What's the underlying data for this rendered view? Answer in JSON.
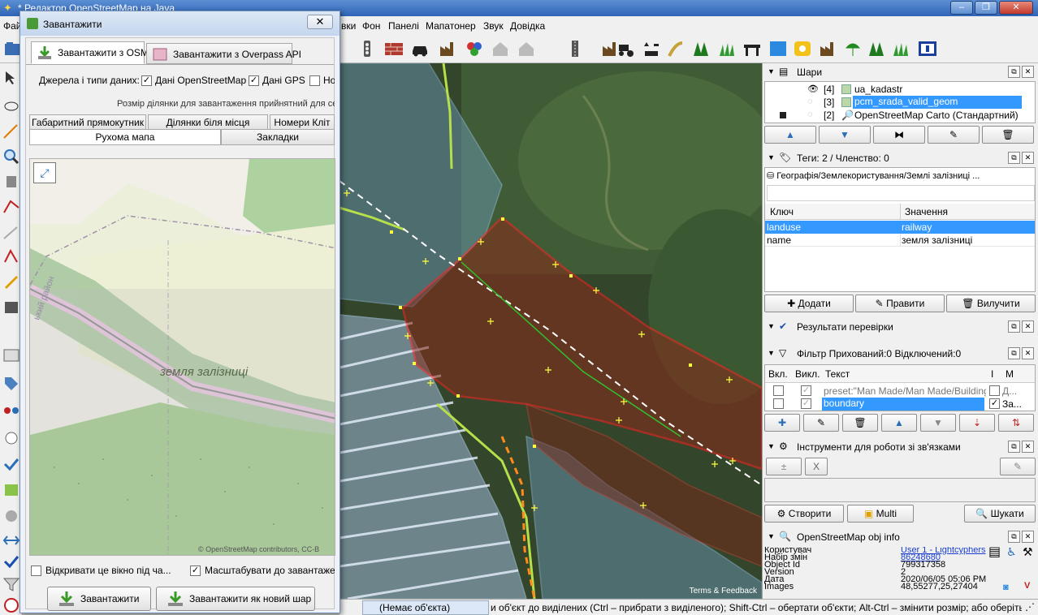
{
  "window": {
    "title": "* Редактор OpenStreetMap на Java"
  },
  "menu": {
    "items": [
      "Фай",
      "вки",
      "Фон",
      "Панелі",
      "Мапатонер",
      "Звук",
      "Довідка"
    ]
  },
  "layers": {
    "title": "Шари",
    "items": [
      {
        "index": "[4]",
        "name": "ua_kadastr"
      },
      {
        "index": "[3]",
        "name": "pcm_srada_valid_geom"
      },
      {
        "index": "[2]",
        "name": "OpenStreetMap Carto (Стандартний)"
      }
    ]
  },
  "tags": {
    "title": "Теги: 2 / Членство: 0",
    "preset": "Географія/Землекористування/Землі залізниці ...",
    "col_key": "Ключ",
    "col_value": "Значення",
    "rows": [
      {
        "key": "landuse",
        "value": "railway"
      },
      {
        "key": "name",
        "value": "земля залізниці"
      }
    ],
    "buttons": {
      "add": "Додати",
      "edit": "Правити",
      "delete": "Вилучити"
    }
  },
  "validation": {
    "title": "Результати перевірки"
  },
  "filter": {
    "title": "Фільтр Прихований:0 Відключений:0",
    "col_enabled": "Вкл.",
    "col_hide": "Викл.",
    "col_text": "Текст",
    "col_i": "I",
    "col_m": "M",
    "rows": [
      {
        "text": "preset:\"Man Made/Man Made/Building\"",
        "m": "Д..."
      },
      {
        "text": "boundary",
        "m": "За..."
      }
    ]
  },
  "relations": {
    "title": "Інструменти для роботи зі зв'язками",
    "buttons": {
      "create": "Створити",
      "multi": "Multi",
      "search": "Шукати"
    }
  },
  "objinfo": {
    "title": "OpenStreetMap obj info",
    "rows": [
      {
        "label": "Користувач",
        "value": "User 1 - Lightcyphers"
      },
      {
        "label": "Набір змін",
        "value": "86248680"
      },
      {
        "label": "Object Id",
        "value": "799317358"
      },
      {
        "label": "Version",
        "value": "2"
      },
      {
        "label": "Дата",
        "value": "2020/06/05 05:06 PM"
      },
      {
        "label": "Images",
        "value": "48,55277,25,27404"
      }
    ]
  },
  "status": {
    "selection": "(Немає об'єкта)",
    "help": "и об'єкт до виділених (Ctrl – прибрати з виділеного); Shift-Ctrl – обертати об'єкти; Alt-Ctrl – змінити розмір; або оберіть інший об'єкт"
  },
  "map": {
    "attribution": "Terms & Feedback"
  },
  "download_dialog": {
    "title": "Завантажити",
    "tab_osm": "Завантажити з OSM",
    "tab_overpass": "Завантажити з Overpass API",
    "sources_label": "Джерела і типи даних:",
    "src_osm": "Дані OpenStreetMap",
    "src_gps": "Дані GPS",
    "src_notes": "Нот",
    "size_note": "Розмір ділянки для завантаження прийнятний для се",
    "subtabs_row1": [
      "Габаритний прямокутник",
      "Ділянки біля місця",
      "Номери Кліт"
    ],
    "subtabs_row2": [
      "Рухома мапа",
      "Закладки"
    ],
    "minimap_label": "земля залізниці",
    "minimap_district": "ький район",
    "minimap_attrib": "© OpenStreetMap contributors, CC-B",
    "open_on_start": "Відкривати це вікно під ча...",
    "zoom_to_download": "Масштабувати до завантажених",
    "btn_download": "Завантажити",
    "btn_download_new_layer": "Завантажити як новий шар"
  }
}
